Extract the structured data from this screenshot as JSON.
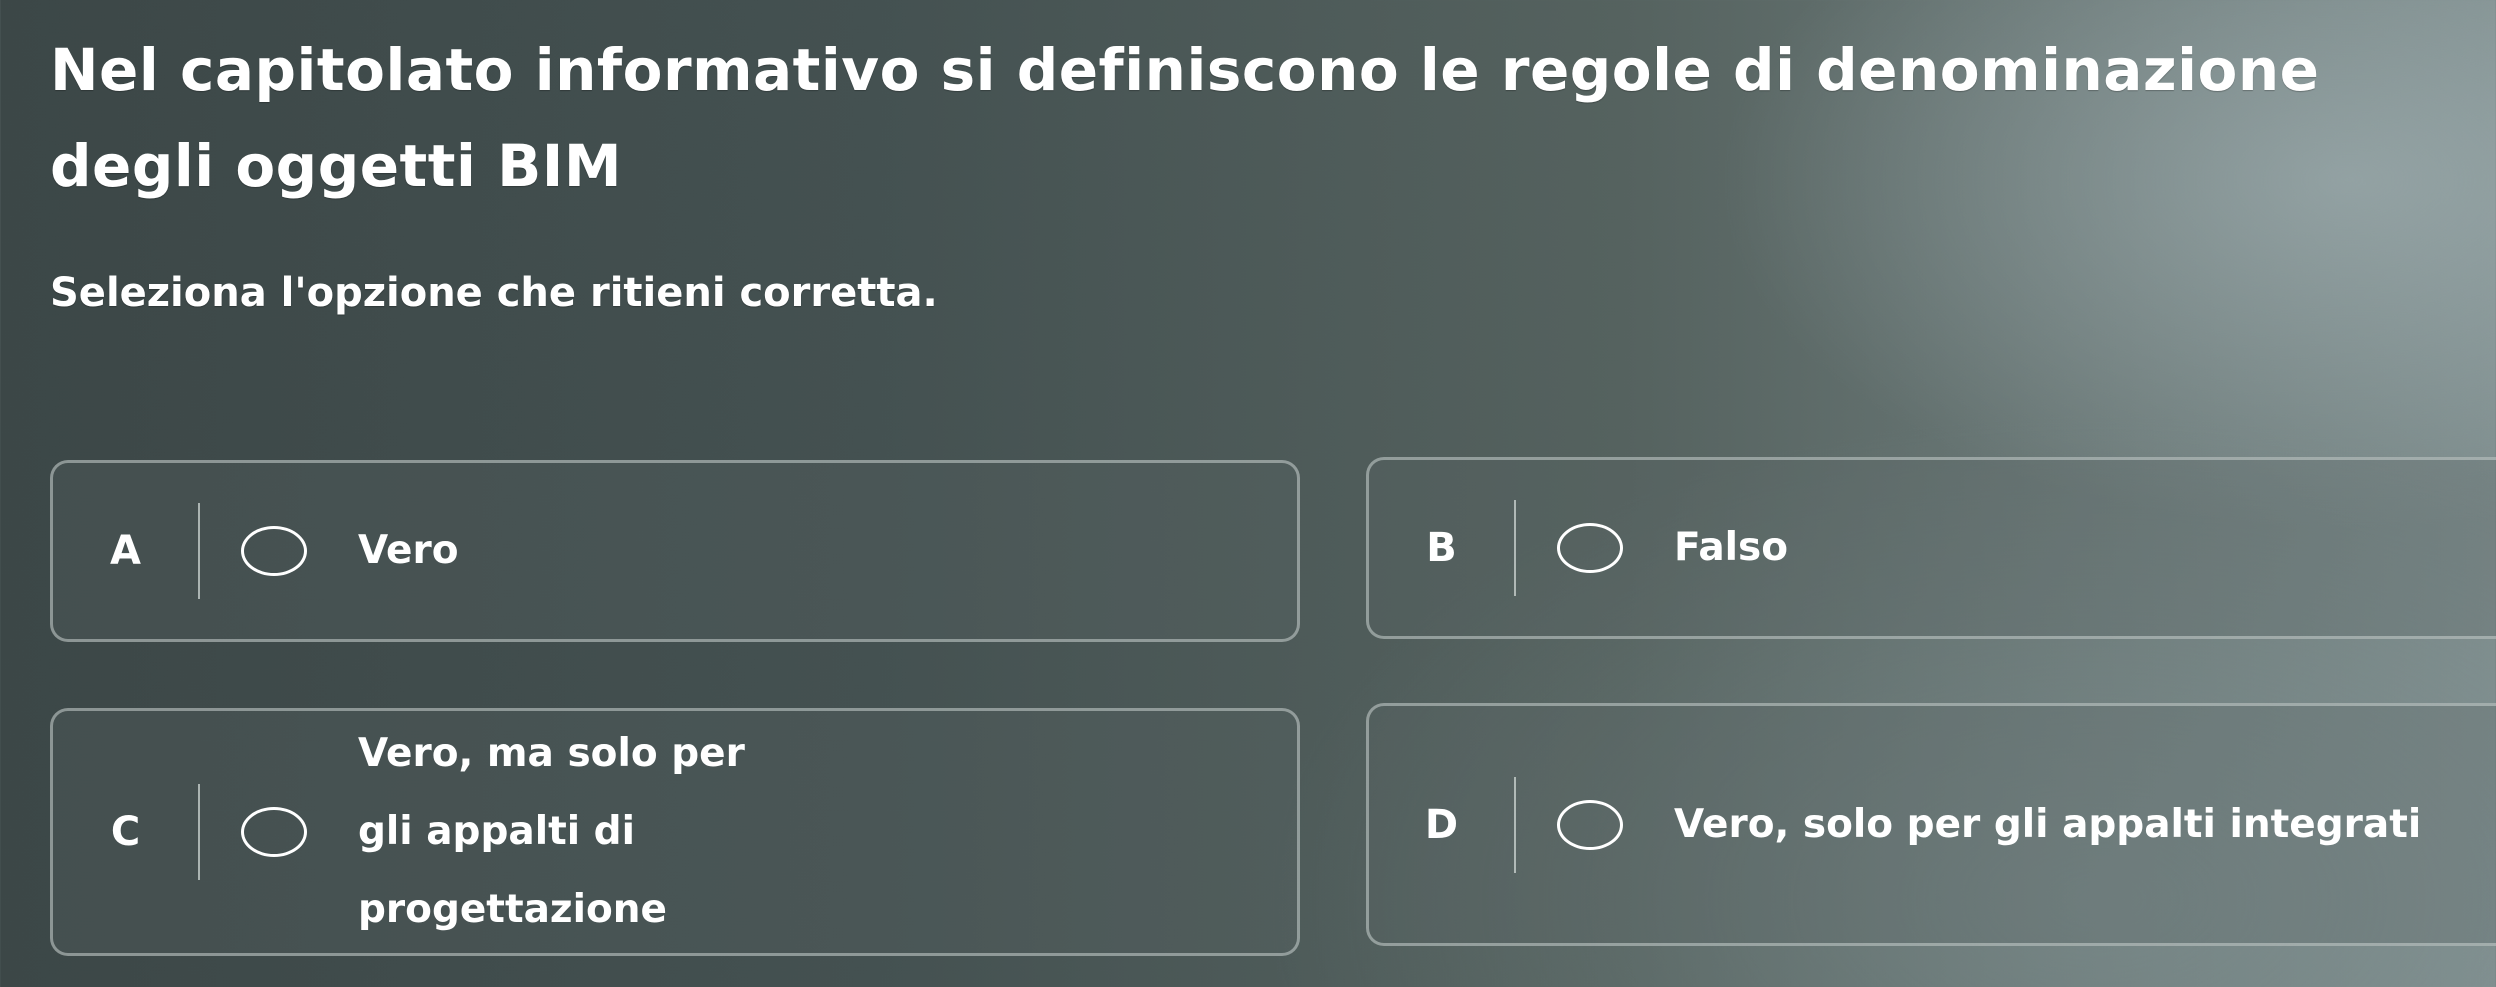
{
  "question": {
    "text": "Nel capitolato informativo si definiscono le regole di denominazione degli oggetti BIM"
  },
  "instruction": "Seleziona l'opzione che ritieni corretta.",
  "options": [
    {
      "letter": "A",
      "label": "Vero",
      "selected": false
    },
    {
      "letter": "B",
      "label": "Falso",
      "selected": false
    },
    {
      "letter": "C",
      "label": "Vero, ma solo per gli appalti di progettazione",
      "selected": false
    },
    {
      "letter": "D",
      "label": "Vero, solo per gli appalti integrati",
      "selected": false
    }
  ]
}
